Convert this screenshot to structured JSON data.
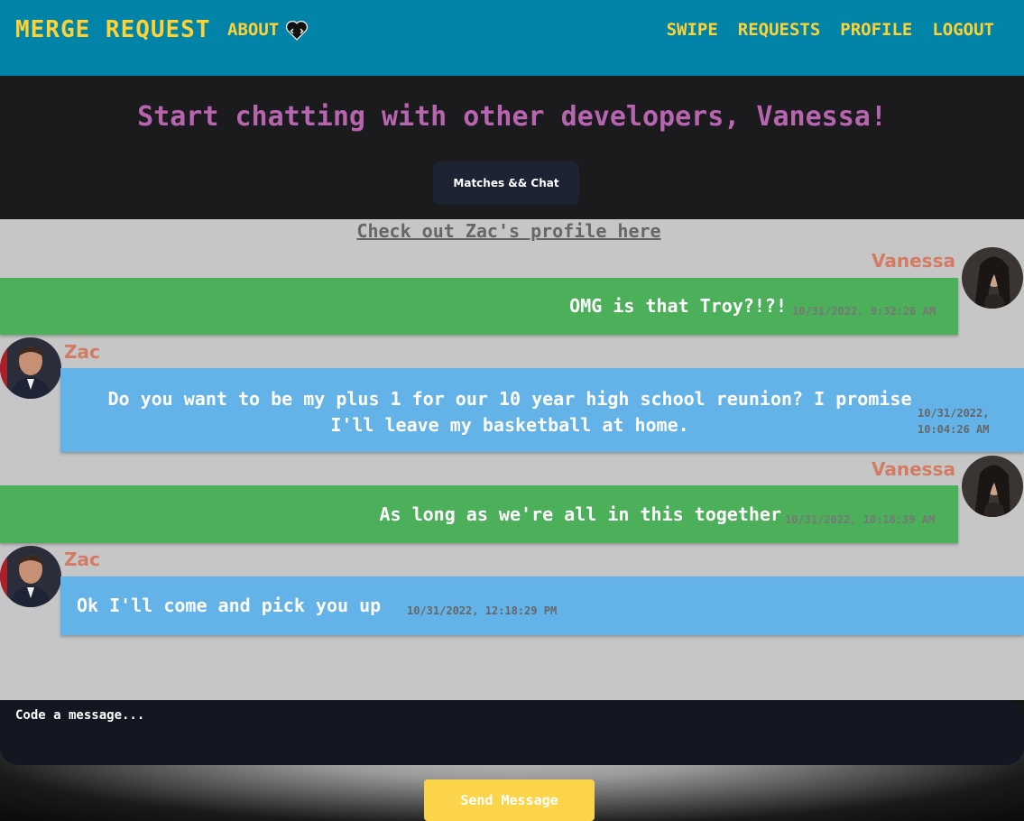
{
  "nav": {
    "brand": "MERGE REQUEST",
    "about": "ABOUT",
    "heart_icon": "heart-code-icon",
    "links": [
      "SWIPE",
      "REQUESTS",
      "PROFILE",
      "LOGOUT"
    ]
  },
  "hero": {
    "title": "Start chatting with other developers, Vanessa!",
    "matches_button": "Matches && Chat"
  },
  "chat": {
    "profile_link": "Check out Zac's profile here",
    "messages": [
      {
        "sender": "Vanessa",
        "text": "OMG is that Troy?!?!",
        "timestamp": "10/31/2022, 9:32:26 AM",
        "side": "right",
        "color": "#4caf5a"
      },
      {
        "sender": "Zac",
        "text": "Do you want to be my plus 1 for our 10 year high school reunion? I promise I'll leave my basketball at home.",
        "timestamp": "10/31/2022, 10:04:26 AM",
        "side": "left",
        "color": "#63b2e8"
      },
      {
        "sender": "Vanessa",
        "text": "As long as we're all in this together",
        "timestamp": "10/31/2022, 10:18:39 AM",
        "side": "right",
        "color": "#4caf5a"
      },
      {
        "sender": "Zac",
        "text": "Ok I'll come and pick you up",
        "timestamp": "10/31/2022, 12:18:29 PM",
        "side": "left",
        "color": "#63b2e8"
      }
    ]
  },
  "composer": {
    "placeholder": "Code a message...",
    "send_label": "Send Message"
  },
  "colors": {
    "nav_bg": "#0284a8",
    "accent_yellow": "#fcd234",
    "hero_bg": "#1b1b1d",
    "title_purple": "#b865b0",
    "name_color": "#d47b63"
  }
}
